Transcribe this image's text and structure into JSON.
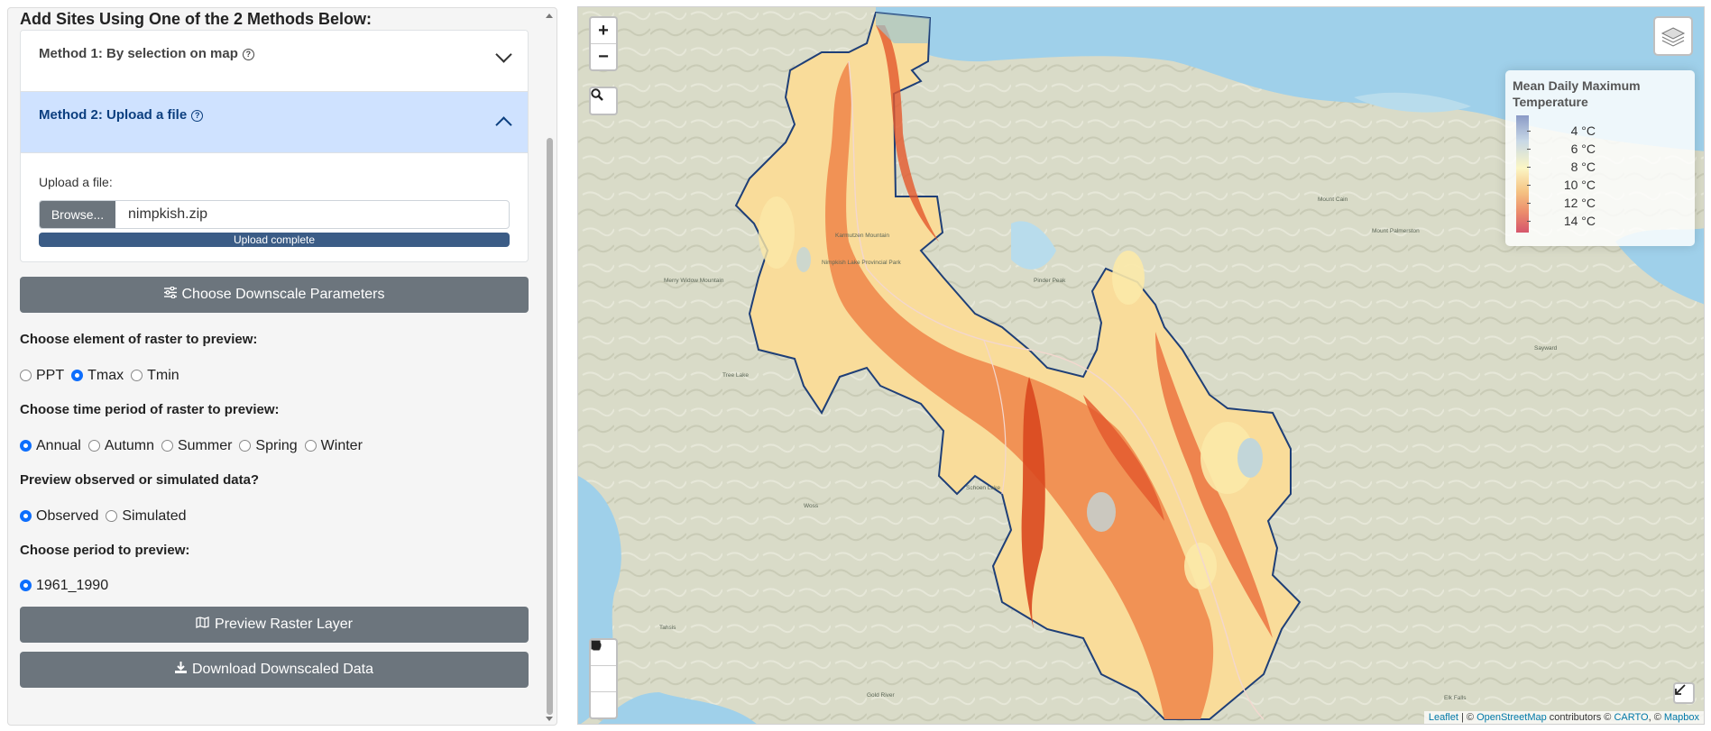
{
  "panel": {
    "heading": "Add Sites Using One of the 2 Methods Below:",
    "method1_title": "Method 1: By selection on map",
    "method2_title": "Method 2: Upload a file",
    "help_glyph": "?",
    "upload_label": "Upload a file:",
    "browse_label": "Browse...",
    "file_name": "nimpkish.zip",
    "upload_status": "Upload complete",
    "upload_progress": 1.0,
    "downscale_button": "Choose Downscale Parameters",
    "element_question": "Choose element of raster to preview:",
    "element_options": [
      "PPT",
      "Tmax",
      "Tmin"
    ],
    "element_selected": "Tmax",
    "time_question": "Choose time period of raster to preview:",
    "time_options": [
      "Annual",
      "Autumn",
      "Summer",
      "Spring",
      "Winter"
    ],
    "time_selected": "Annual",
    "data_question": "Preview observed or simulated data?",
    "data_options": [
      "Observed",
      "Simulated"
    ],
    "data_selected": "Observed",
    "period_question": "Choose period to preview:",
    "period_options": [
      "1961_1990"
    ],
    "period_selected": "1961_1990",
    "preview_button": "Preview Raster Layer",
    "download_button": "Download Downscaled Data"
  },
  "map": {
    "zoom_in": "+",
    "zoom_out": "−",
    "legend_title": "Mean Daily Maximum Temperature",
    "legend_items": [
      "4 °C",
      "6 °C",
      "8 °C",
      "10 °C",
      "12 °C",
      "14 °C"
    ],
    "attribution": {
      "leaflet": "Leaflet",
      "sep1": " | © ",
      "osm": "OpenStreetMap",
      "contrib": " contributors © ",
      "carto": "CARTO",
      "sep2": ", © ",
      "mapbox": "Mapbox"
    },
    "colors": {
      "water": "#9fd0ea",
      "land": "#d9dbc8",
      "hot": "#e4572c",
      "warm": "#f5a05a",
      "mild": "#fbe9a8",
      "cool": "#c2d6d9",
      "boundary": "#1f3f77"
    }
  }
}
